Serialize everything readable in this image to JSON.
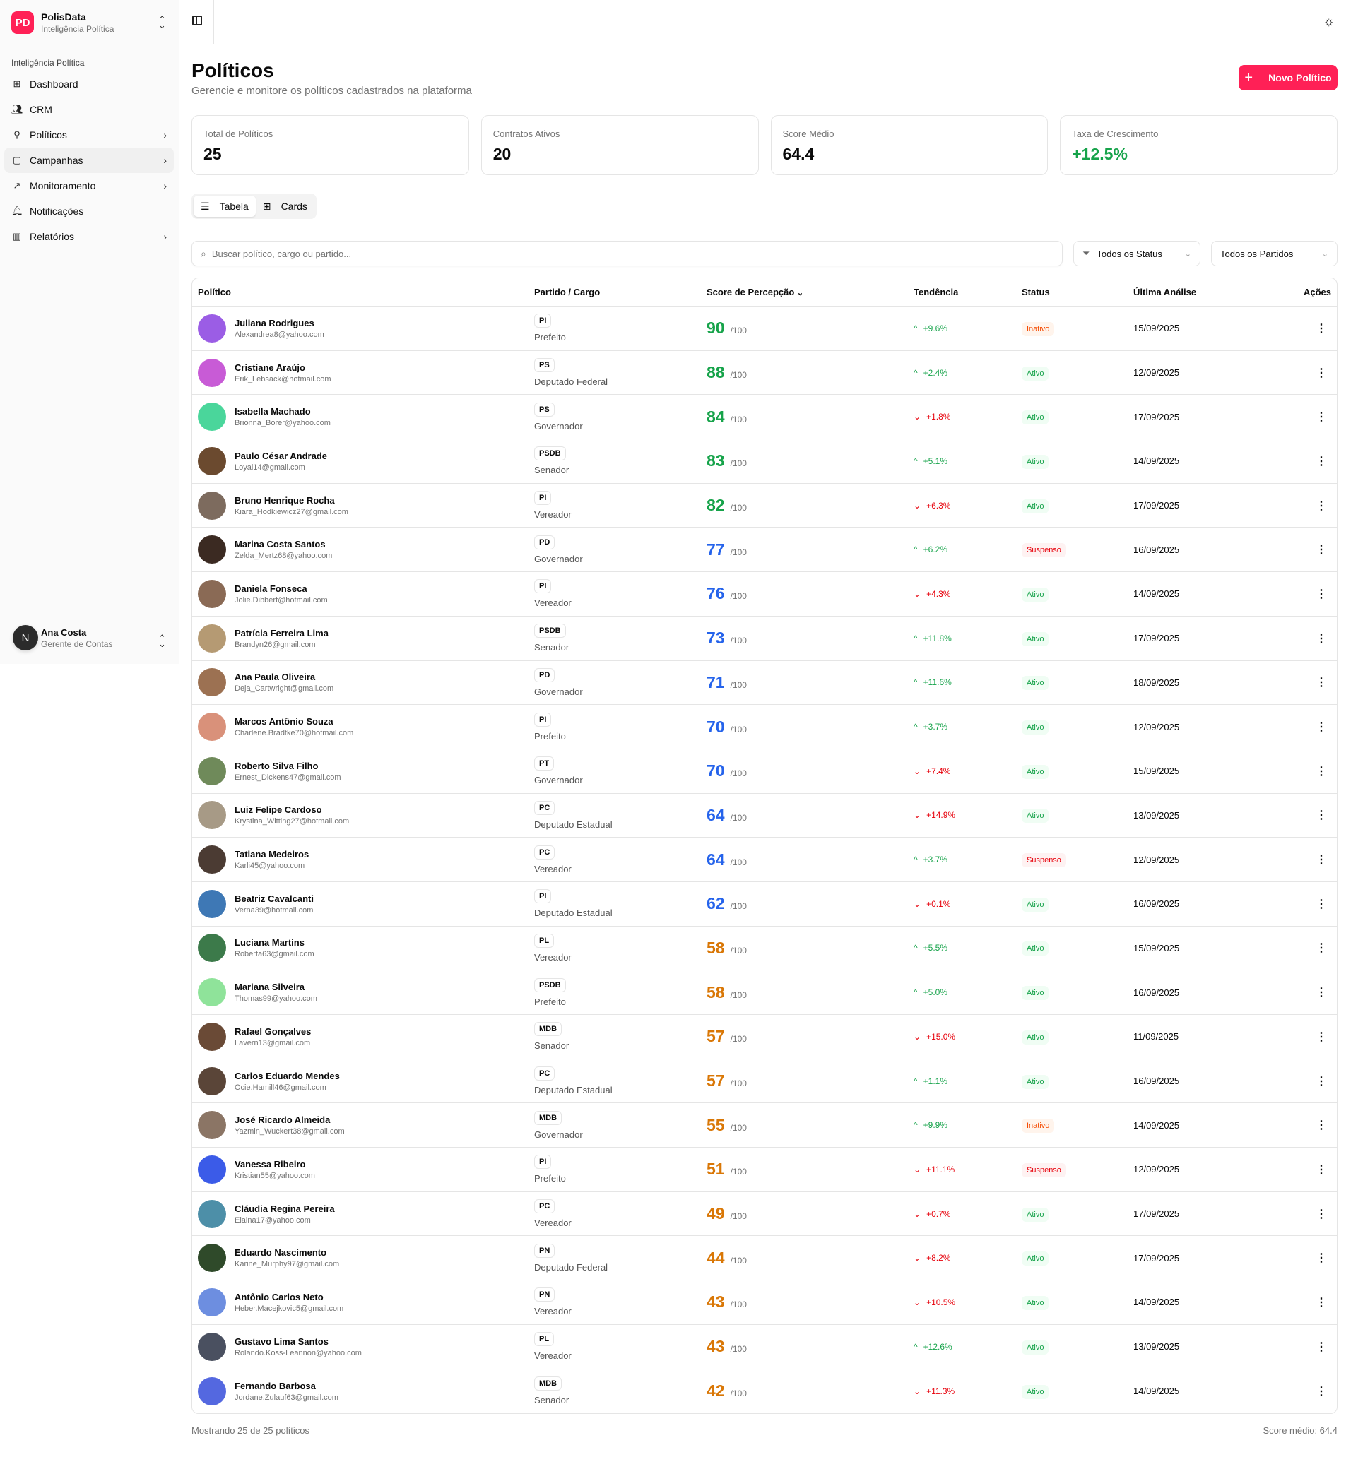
{
  "app": {
    "name": "PolisData",
    "subtitle": "Inteligência Política",
    "logo": "PD"
  },
  "sidebar": {
    "group_label": "Inteligência Política",
    "items": [
      {
        "label": "Dashboard",
        "icon": "grid-icon"
      },
      {
        "label": "CRM",
        "icon": "users-icon"
      },
      {
        "label": "Políticos",
        "icon": "user-check-icon",
        "chevron": true
      },
      {
        "label": "Campanhas",
        "icon": "message-square-icon",
        "chevron": true,
        "active": true
      },
      {
        "label": "Monitoramento",
        "icon": "trending-up-icon",
        "chevron": true
      },
      {
        "label": "Notificações",
        "icon": "bell-icon"
      },
      {
        "label": "Relatórios",
        "icon": "bar-chart-icon",
        "chevron": true
      }
    ]
  },
  "user": {
    "initial": "N",
    "name": "Ana Costa",
    "role": "Gerente de Contas"
  },
  "page": {
    "title": "Políticos",
    "subtitle": "Gerencie e monitore os políticos cadastrados na plataforma",
    "new_button": "Novo Político"
  },
  "stats": [
    {
      "label": "Total de Políticos",
      "value": "25"
    },
    {
      "label": "Contratos Ativos",
      "value": "20"
    },
    {
      "label": "Score Médio",
      "value": "64.4"
    },
    {
      "label": "Taxa de Crescimento",
      "value": "+12.5%",
      "accent": "#16a34a"
    }
  ],
  "view_toggle": {
    "table": "Tabela",
    "cards": "Cards",
    "active": "table"
  },
  "search": {
    "placeholder": "Buscar político, cargo ou partido...",
    "value": ""
  },
  "filters": {
    "status": "Todos os Status",
    "party": "Todos os Partidos"
  },
  "table": {
    "headers": {
      "politico": "Político",
      "partido": "Partido / Cargo",
      "score": "Score de Percepção",
      "tendencia": "Tendência",
      "status": "Status",
      "ultima": "Última Análise",
      "acoes": "Ações"
    },
    "score_suffix": "/100",
    "rows": [
      {
        "name": "Juliana Rodrigues",
        "email": "Alexandrea8@yahoo.com",
        "party": "PI",
        "role": "Prefeito",
        "score": 90,
        "trend_dir": "up",
        "trend": "+9.6%",
        "status": "Inativo",
        "date": "15/09/2025",
        "avatar_color": "#9b5de5"
      },
      {
        "name": "Cristiane Araújo",
        "email": "Erik_Lebsack@hotmail.com",
        "party": "PS",
        "role": "Deputado Federal",
        "score": 88,
        "trend_dir": "up",
        "trend": "+2.4%",
        "status": "Ativo",
        "date": "12/09/2025",
        "avatar_color": "#c85bd6"
      },
      {
        "name": "Isabella Machado",
        "email": "Brionna_Borer@yahoo.com",
        "party": "PS",
        "role": "Governador",
        "score": 84,
        "trend_dir": "down",
        "trend": "+1.8%",
        "status": "Ativo",
        "date": "17/09/2025",
        "avatar_color": "#4ad69b"
      },
      {
        "name": "Paulo César Andrade",
        "email": "Loyal14@gmail.com",
        "party": "PSDB",
        "role": "Senador",
        "score": 83,
        "trend_dir": "up",
        "trend": "+5.1%",
        "status": "Ativo",
        "date": "14/09/2025",
        "avatar_color": "#6b4a2f"
      },
      {
        "name": "Bruno Henrique Rocha",
        "email": "Kiara_Hodkiewicz27@gmail.com",
        "party": "PI",
        "role": "Vereador",
        "score": 82,
        "trend_dir": "down",
        "trend": "+6.3%",
        "status": "Ativo",
        "date": "17/09/2025",
        "avatar_color": "#7d6b5e"
      },
      {
        "name": "Marina Costa Santos",
        "email": "Zelda_Mertz68@yahoo.com",
        "party": "PD",
        "role": "Governador",
        "score": 77,
        "trend_dir": "up",
        "trend": "+6.2%",
        "status": "Suspenso",
        "date": "16/09/2025",
        "avatar_color": "#3b2a22"
      },
      {
        "name": "Daniela Fonseca",
        "email": "Jolie.Dibbert@hotmail.com",
        "party": "PI",
        "role": "Vereador",
        "score": 76,
        "trend_dir": "down",
        "trend": "+4.3%",
        "status": "Ativo",
        "date": "14/09/2025",
        "avatar_color": "#8a6a55"
      },
      {
        "name": "Patrícia Ferreira Lima",
        "email": "Brandyn26@gmail.com",
        "party": "PSDB",
        "role": "Senador",
        "score": 73,
        "trend_dir": "up",
        "trend": "+11.8%",
        "status": "Ativo",
        "date": "17/09/2025",
        "avatar_color": "#b59a73"
      },
      {
        "name": "Ana Paula Oliveira",
        "email": "Deja_Cartwright@gmail.com",
        "party": "PD",
        "role": "Governador",
        "score": 71,
        "trend_dir": "up",
        "trend": "+11.6%",
        "status": "Ativo",
        "date": "18/09/2025",
        "avatar_color": "#9c7152"
      },
      {
        "name": "Marcos Antônio Souza",
        "email": "Charlene.Bradtke70@hotmail.com",
        "party": "PI",
        "role": "Prefeito",
        "score": 70,
        "trend_dir": "up",
        "trend": "+3.7%",
        "status": "Ativo",
        "date": "12/09/2025",
        "avatar_color": "#d9917a"
      },
      {
        "name": "Roberto Silva Filho",
        "email": "Ernest_Dickens47@gmail.com",
        "party": "PT",
        "role": "Governador",
        "score": 70,
        "trend_dir": "down",
        "trend": "+7.4%",
        "status": "Ativo",
        "date": "15/09/2025",
        "avatar_color": "#6f8a5a"
      },
      {
        "name": "Luiz Felipe Cardoso",
        "email": "Krystina_Witting27@hotmail.com",
        "party": "PC",
        "role": "Deputado Estadual",
        "score": 64,
        "trend_dir": "down",
        "trend": "+14.9%",
        "status": "Ativo",
        "date": "13/09/2025",
        "avatar_color": "#a79a86"
      },
      {
        "name": "Tatiana Medeiros",
        "email": "Karli45@yahoo.com",
        "party": "PC",
        "role": "Vereador",
        "score": 64,
        "trend_dir": "up",
        "trend": "+3.7%",
        "status": "Suspenso",
        "date": "12/09/2025",
        "avatar_color": "#4b3b33"
      },
      {
        "name": "Beatriz Cavalcanti",
        "email": "Verna39@hotmail.com",
        "party": "PI",
        "role": "Deputado Estadual",
        "score": 62,
        "trend_dir": "down",
        "trend": "+0.1%",
        "status": "Ativo",
        "date": "16/09/2025",
        "avatar_color": "#3e78b5"
      },
      {
        "name": "Luciana Martins",
        "email": "Roberta63@gmail.com",
        "party": "PL",
        "role": "Vereador",
        "score": 58,
        "trend_dir": "up",
        "trend": "+5.5%",
        "status": "Ativo",
        "date": "15/09/2025",
        "avatar_color": "#3c7a4a"
      },
      {
        "name": "Mariana Silveira",
        "email": "Thomas99@yahoo.com",
        "party": "PSDB",
        "role": "Prefeito",
        "score": 58,
        "trend_dir": "up",
        "trend": "+5.0%",
        "status": "Ativo",
        "date": "16/09/2025",
        "avatar_color": "#8fe39a"
      },
      {
        "name": "Rafael Gonçalves",
        "email": "Lavern13@gmail.com",
        "party": "MDB",
        "role": "Senador",
        "score": 57,
        "trend_dir": "down",
        "trend": "+15.0%",
        "status": "Ativo",
        "date": "11/09/2025",
        "avatar_color": "#6a4a36"
      },
      {
        "name": "Carlos Eduardo Mendes",
        "email": "Ocie.Hamill46@gmail.com",
        "party": "PC",
        "role": "Deputado Estadual",
        "score": 57,
        "trend_dir": "up",
        "trend": "+1.1%",
        "status": "Ativo",
        "date": "16/09/2025",
        "avatar_color": "#5a4538"
      },
      {
        "name": "José Ricardo Almeida",
        "email": "Yazmin_Wuckert38@gmail.com",
        "party": "MDB",
        "role": "Governador",
        "score": 55,
        "trend_dir": "up",
        "trend": "+9.9%",
        "status": "Inativo",
        "date": "14/09/2025",
        "avatar_color": "#8b7565"
      },
      {
        "name": "Vanessa Ribeiro",
        "email": "Kristian55@yahoo.com",
        "party": "PI",
        "role": "Prefeito",
        "score": 51,
        "trend_dir": "down",
        "trend": "+11.1%",
        "status": "Suspenso",
        "date": "12/09/2025",
        "avatar_color": "#3b5be8"
      },
      {
        "name": "Cláudia Regina Pereira",
        "email": "Elaina17@yahoo.com",
        "party": "PC",
        "role": "Vereador",
        "score": 49,
        "trend_dir": "down",
        "trend": "+0.7%",
        "status": "Ativo",
        "date": "17/09/2025",
        "avatar_color": "#4d8fa8"
      },
      {
        "name": "Eduardo Nascimento",
        "email": "Karine_Murphy97@gmail.com",
        "party": "PN",
        "role": "Deputado Federal",
        "score": 44,
        "trend_dir": "down",
        "trend": "+8.2%",
        "status": "Ativo",
        "date": "17/09/2025",
        "avatar_color": "#2f4a2a"
      },
      {
        "name": "Antônio Carlos Neto",
        "email": "Heber.Macejkovic5@gmail.com",
        "party": "PN",
        "role": "Vereador",
        "score": 43,
        "trend_dir": "down",
        "trend": "+10.5%",
        "status": "Ativo",
        "date": "14/09/2025",
        "avatar_color": "#6d8ee0"
      },
      {
        "name": "Gustavo Lima Santos",
        "email": "Rolando.Koss-Leannon@yahoo.com",
        "party": "PL",
        "role": "Vereador",
        "score": 43,
        "trend_dir": "up",
        "trend": "+12.6%",
        "status": "Ativo",
        "date": "13/09/2025",
        "avatar_color": "#4a5060"
      },
      {
        "name": "Fernando Barbosa",
        "email": "Jordane.Zulauf63@gmail.com",
        "party": "MDB",
        "role": "Senador",
        "score": 42,
        "trend_dir": "down",
        "trend": "+11.3%",
        "status": "Ativo",
        "date": "14/09/2025",
        "avatar_color": "#5468e0"
      }
    ]
  },
  "footer": {
    "showing": "Mostrando 25 de 25 políticos",
    "avg": "Score médio: 64.4"
  },
  "colors": {
    "brand": "#ff2056",
    "score_high": "#16a34a",
    "score_mid": "#2563eb",
    "score_low": "#d97706"
  }
}
